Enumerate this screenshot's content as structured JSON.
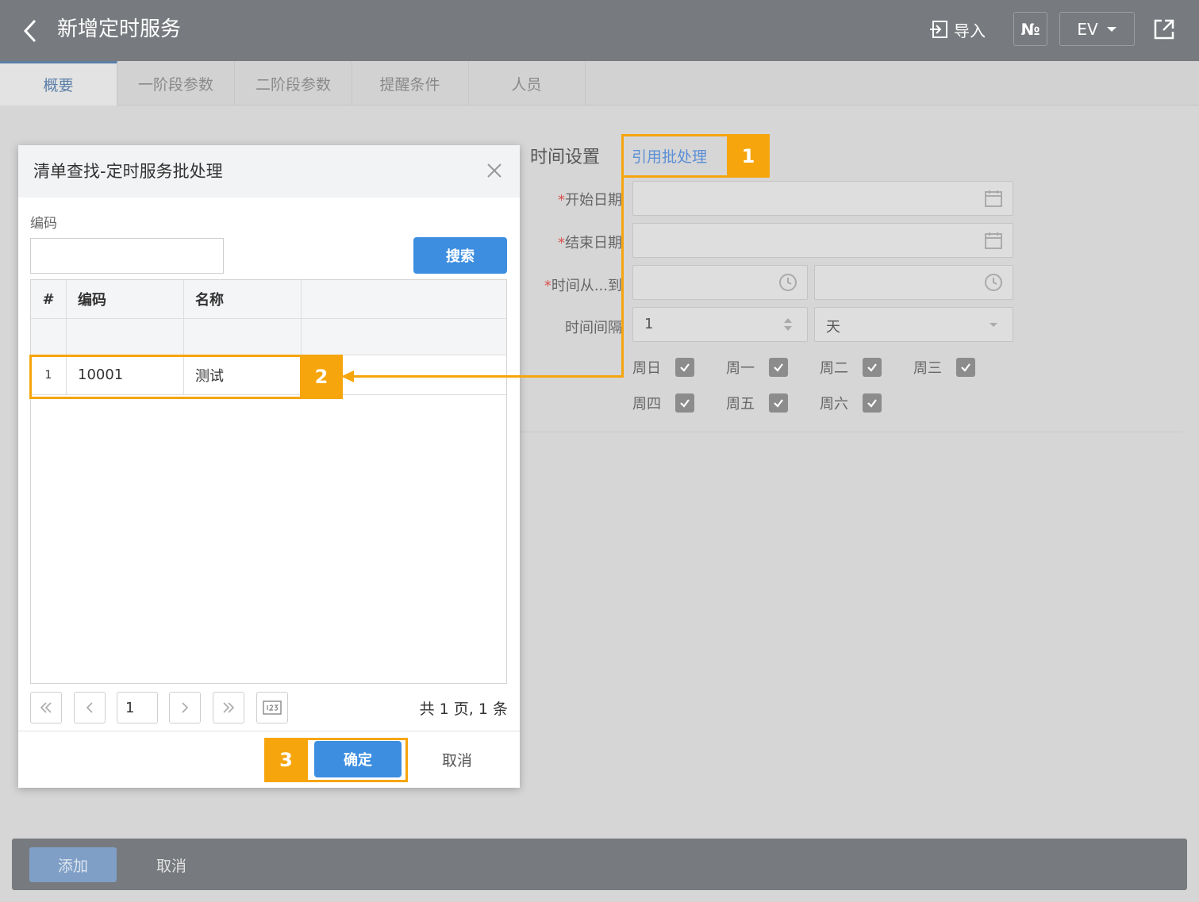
{
  "header": {
    "title": "新增定时服务",
    "import_label": "导入",
    "no_label": "№",
    "ev_label": "EV"
  },
  "tabs": [
    {
      "label": "概要",
      "active": true
    },
    {
      "label": "一阶段参数"
    },
    {
      "label": "二阶段参数"
    },
    {
      "label": "提醒条件"
    },
    {
      "label": "人员"
    }
  ],
  "form": {
    "section_title": "时间设置",
    "reference_link": "引用批处理",
    "required_mark": "*",
    "start_date_label": "开始日期",
    "end_date_label": "结束日期",
    "time_range_label": "时间从...到",
    "interval_label": "时间间隔",
    "interval_value": "1",
    "interval_unit": "天",
    "weekdays": [
      "周日",
      "周一",
      "周二",
      "周三",
      "周四",
      "周五",
      "周六"
    ]
  },
  "dialog": {
    "title": "清单查找-定时服务批处理",
    "code_label": "编码",
    "search_button": "搜索",
    "columns": [
      "#",
      "编码",
      "名称"
    ],
    "rows": [
      {
        "num": "1",
        "code": "10001",
        "name": "测试"
      }
    ],
    "page_value": "1",
    "page_info": "共 1 页, 1 条",
    "ok_button": "确定",
    "cancel_button": "取消"
  },
  "bottom": {
    "add_button": "添加",
    "cancel_button": "取消"
  },
  "annotations": {
    "step1": "1",
    "step2": "2",
    "step3": "3",
    "color": "#f6a50c"
  }
}
